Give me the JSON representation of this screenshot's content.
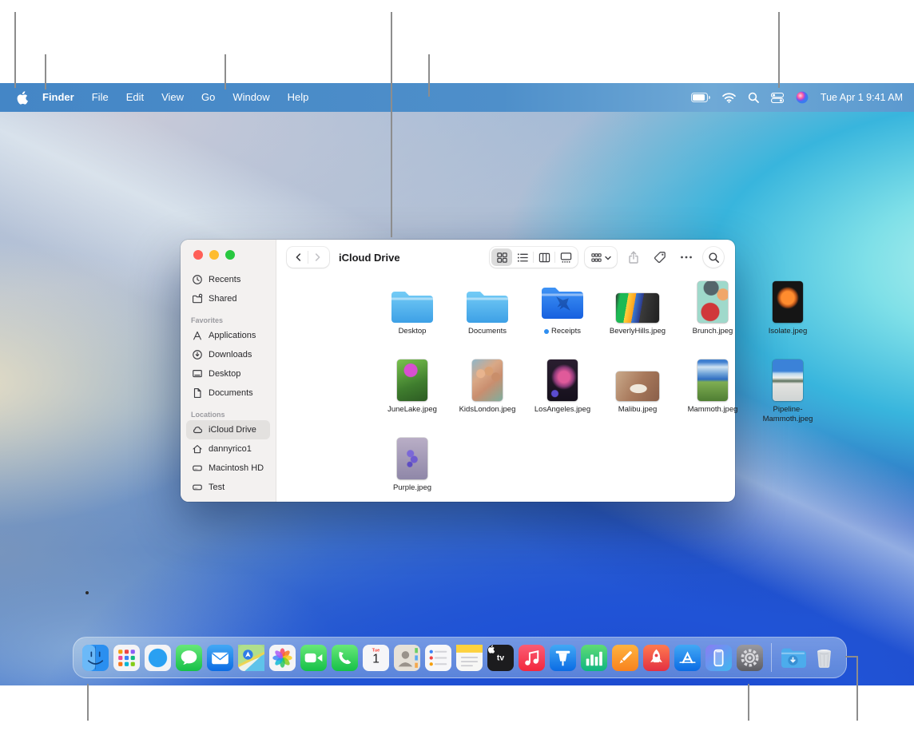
{
  "menu_bar": {
    "apple_menu": "apple-logo",
    "items": [
      "Finder",
      "File",
      "Edit",
      "View",
      "Go",
      "Window",
      "Help"
    ],
    "status": {
      "icons": [
        "battery",
        "wifi",
        "spotlight-search",
        "control-center",
        "siri"
      ],
      "clock": "Tue Apr 1  9:41 AM"
    }
  },
  "finder_window": {
    "title": "iCloud Drive",
    "traffic_lights": {
      "close": "#ff5f57",
      "minimize": "#febc2e",
      "zoom": "#28c840"
    },
    "toolbar": {
      "view_modes": [
        "icon-view",
        "list-view",
        "column-view",
        "gallery-view"
      ],
      "selected_view": "icon-view",
      "buttons": [
        "group-by",
        "share",
        "tags",
        "more-options",
        "search"
      ]
    },
    "sidebar": {
      "top_items": [
        {
          "label": "Recents",
          "icon": "clock"
        },
        {
          "label": "Shared",
          "icon": "shared-folder"
        }
      ],
      "sections": [
        {
          "heading": "Favorites",
          "items": [
            {
              "label": "Applications",
              "icon": "applications"
            },
            {
              "label": "Downloads",
              "icon": "download-circle"
            },
            {
              "label": "Desktop",
              "icon": "desktop"
            },
            {
              "label": "Documents",
              "icon": "document"
            }
          ]
        },
        {
          "heading": "Locations",
          "items": [
            {
              "label": "iCloud Drive",
              "icon": "cloud",
              "selected": true
            },
            {
              "label": "dannyrico1",
              "icon": "home"
            },
            {
              "label": "Macintosh HD",
              "icon": "hard-disk"
            },
            {
              "label": "Test",
              "icon": "hard-disk"
            }
          ]
        }
      ]
    },
    "files": [
      {
        "label": "Desktop",
        "type": "folder"
      },
      {
        "label": "Documents",
        "type": "folder"
      },
      {
        "label": "Receipts",
        "type": "folder-airplane",
        "badge_dot": true,
        "badge_dot_color": "#2f8ef0"
      },
      {
        "label": "BeverlyHills.jpeg",
        "type": "image",
        "thumb": "beverlyhills",
        "orientation": "landscape"
      },
      {
        "label": "Brunch.jpeg",
        "type": "image",
        "thumb": "brunch",
        "orientation": "portrait"
      },
      {
        "label": "Isolate.jpeg",
        "type": "image",
        "thumb": "isolate",
        "orientation": "portrait"
      },
      {
        "label": "JuneLake.jpeg",
        "type": "image",
        "thumb": "junelake",
        "orientation": "portrait"
      },
      {
        "label": "KidsLondon.jpeg",
        "type": "image",
        "thumb": "kidslondon",
        "orientation": "portrait"
      },
      {
        "label": "LosAngeles.jpeg",
        "type": "image",
        "thumb": "losangeles",
        "orientation": "portrait"
      },
      {
        "label": "Malibu.jpeg",
        "type": "image",
        "thumb": "malibu",
        "orientation": "landscape"
      },
      {
        "label": "Mammoth.jpeg",
        "type": "image",
        "thumb": "mammoth",
        "orientation": "portrait"
      },
      {
        "label": "Pipeline-Mammoth.jpeg",
        "type": "image",
        "thumb": "pipeline",
        "orientation": "portrait"
      },
      {
        "label": "Purple.jpeg",
        "type": "image",
        "thumb": "purple",
        "orientation": "portrait"
      }
    ]
  },
  "dock": {
    "apps": [
      {
        "id": "finder",
        "running": true
      },
      {
        "id": "launchpad"
      },
      {
        "id": "safari"
      },
      {
        "id": "messages"
      },
      {
        "id": "mail"
      },
      {
        "id": "maps"
      },
      {
        "id": "photos"
      },
      {
        "id": "facetime"
      },
      {
        "id": "phone"
      },
      {
        "id": "calendar"
      },
      {
        "id": "contacts"
      },
      {
        "id": "reminders"
      },
      {
        "id": "notes"
      },
      {
        "id": "apple-tv"
      },
      {
        "id": "music"
      },
      {
        "id": "keynote"
      },
      {
        "id": "numbers"
      },
      {
        "id": "pages"
      },
      {
        "id": "rocket-app"
      },
      {
        "id": "app-store"
      },
      {
        "id": "iphone-mirroring"
      },
      {
        "id": "system-settings"
      },
      {
        "id": "downloads-folder",
        "divider_before": true
      },
      {
        "id": "trash"
      }
    ],
    "calendar": {
      "weekday": "Tue",
      "day": "1"
    },
    "tv_label": "tv"
  },
  "colors": {
    "menu_bar_blue": "#4486c6",
    "folder_blue": "#4db2ef",
    "receipts_folder_blue": "#2a7df0",
    "sidebar_selected": "#e3e1df",
    "callout_gray": "#8d8d8d"
  }
}
